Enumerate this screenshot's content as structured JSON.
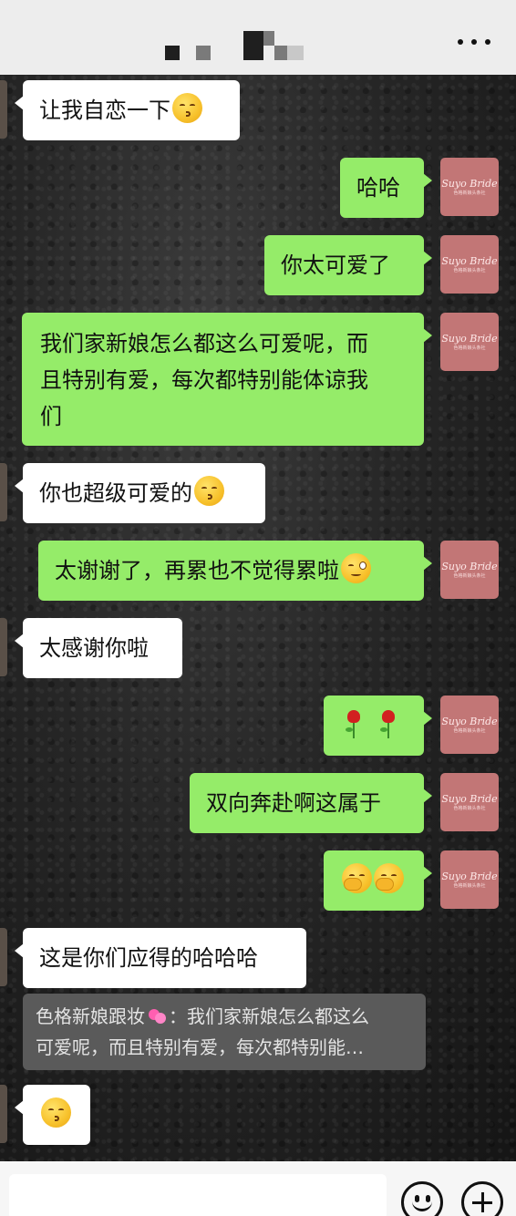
{
  "header": {
    "more_icon": "more-icon"
  },
  "messages": [
    {
      "side": "in",
      "text": "让我自恋一下",
      "emoji": "kiss-face"
    },
    {
      "side": "out",
      "text": "哈哈"
    },
    {
      "side": "out",
      "text": "你太可爱了"
    },
    {
      "side": "out",
      "text": "我们家新娘怎么都这么可爱呢，而\n且特别有爱，每次都特别能体谅我\n们"
    },
    {
      "side": "in",
      "text": "你也超级可爱的",
      "emoji": "kiss-face"
    },
    {
      "side": "out",
      "text": "太谢谢了，再累也不觉得累啦",
      "emoji": "wink-face"
    },
    {
      "side": "in",
      "text": "太感谢你啦"
    },
    {
      "side": "out",
      "text": "",
      "emoji": "rose rose"
    },
    {
      "side": "out",
      "text": "双向奔赴啊这属于"
    },
    {
      "side": "out",
      "text": "",
      "emoji": "hand-over-mouth hand-over-mouth"
    },
    {
      "side": "in",
      "text": "这是你们应得的哈哈哈"
    },
    {
      "side": "in",
      "text": "",
      "emoji": "kiss-face"
    }
  ],
  "avatar": {
    "line1": "Suyo Bride",
    "line2": "色格新娘头条社"
  },
  "quote": {
    "sender": "色格新娘跟妆",
    "sender_emoji": "two-hearts",
    "text": "：我们家新娘怎么都这么\n可爱呢，而且特别有爱，每次都特别能…"
  },
  "input_bar": {
    "emoji_icon": "smile-icon",
    "plus_icon": "plus-icon"
  },
  "colors": {
    "outgoing_bubble": "#95ec69",
    "incoming_bubble": "#ffffff",
    "avatar_bg": "#c27676"
  }
}
